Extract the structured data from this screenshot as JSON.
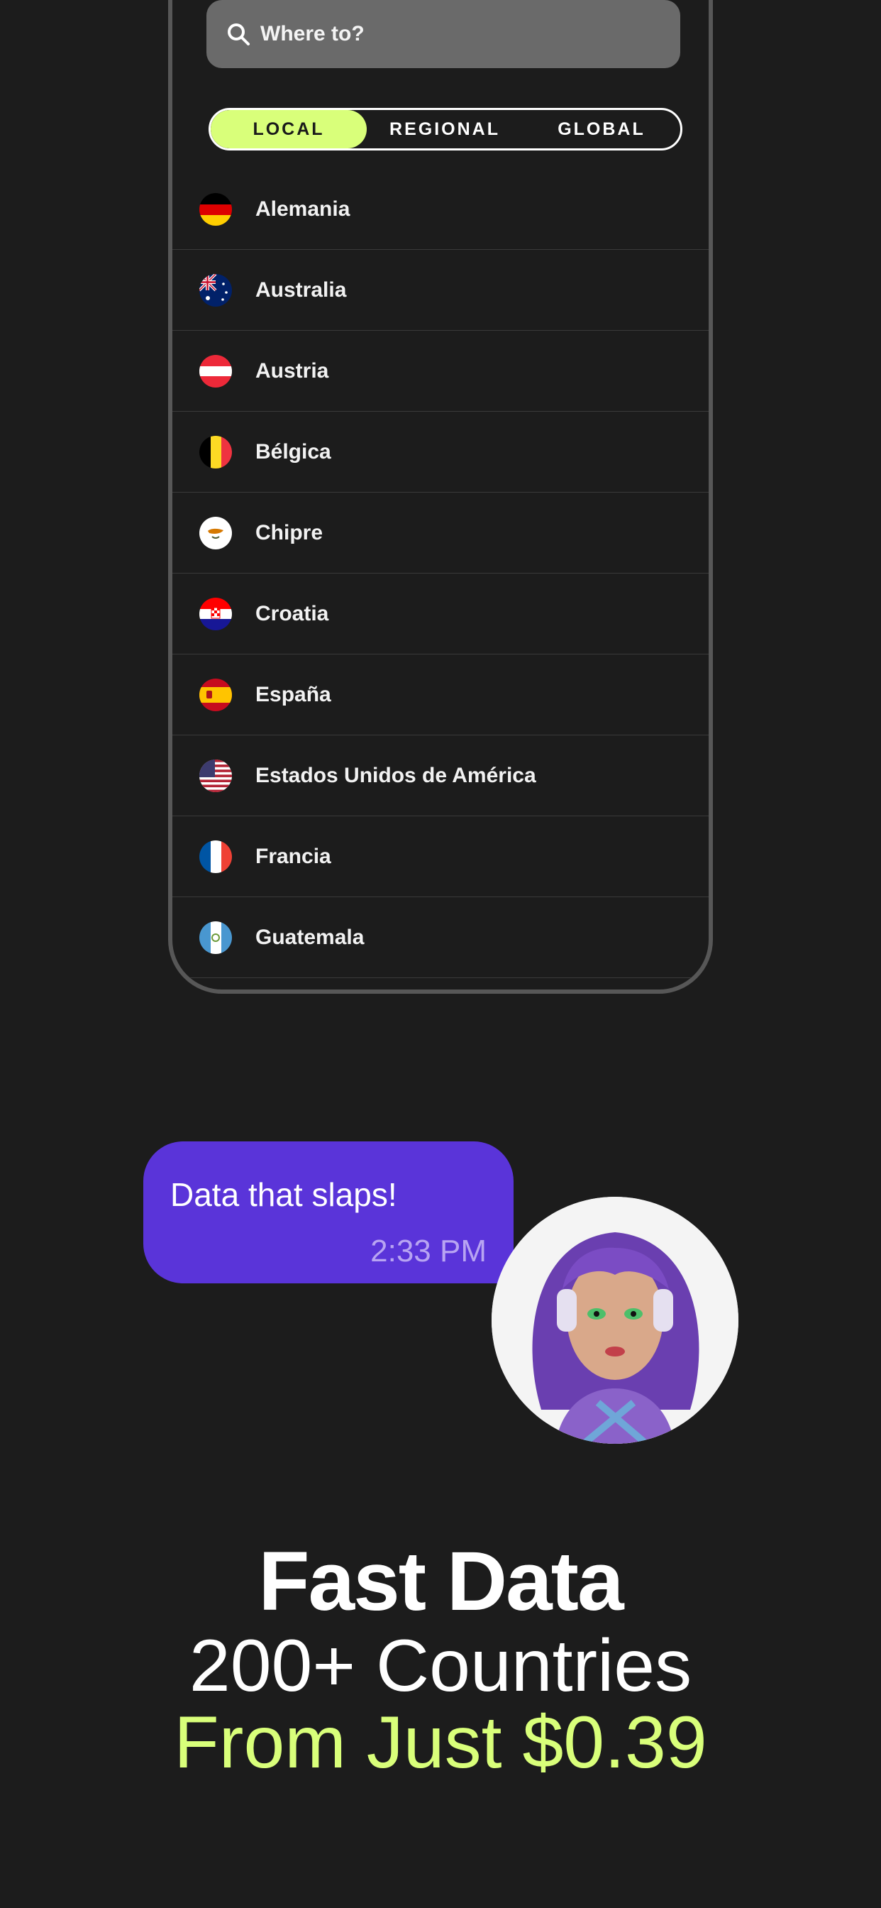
{
  "search": {
    "placeholder": "Where to?"
  },
  "tabs": [
    {
      "label": "LOCAL",
      "active": true
    },
    {
      "label": "REGIONAL",
      "active": false
    },
    {
      "label": "GLOBAL",
      "active": false
    }
  ],
  "countries": [
    {
      "name": "Alemania",
      "flag": "germany-flag-icon"
    },
    {
      "name": "Australia",
      "flag": "australia-flag-icon"
    },
    {
      "name": "Austria",
      "flag": "austria-flag-icon"
    },
    {
      "name": "Bélgica",
      "flag": "belgium-flag-icon"
    },
    {
      "name": "Chipre",
      "flag": "cyprus-flag-icon"
    },
    {
      "name": "Croatia",
      "flag": "croatia-flag-icon"
    },
    {
      "name": "España",
      "flag": "spain-flag-icon"
    },
    {
      "name": "Estados Unidos de América",
      "flag": "usa-flag-icon"
    },
    {
      "name": "Francia",
      "flag": "france-flag-icon"
    },
    {
      "name": "Guatemala",
      "flag": "guatemala-flag-icon"
    }
  ],
  "chat": {
    "message": "Data that slaps!",
    "time": "2:33 PM"
  },
  "headline": {
    "line1": "Fast Data",
    "line2": "200+ Countries",
    "line3": "From Just $0.39"
  },
  "colors": {
    "accent": "#d9ff7a",
    "bubble": "#5a34d9",
    "background": "#1c1c1c"
  }
}
